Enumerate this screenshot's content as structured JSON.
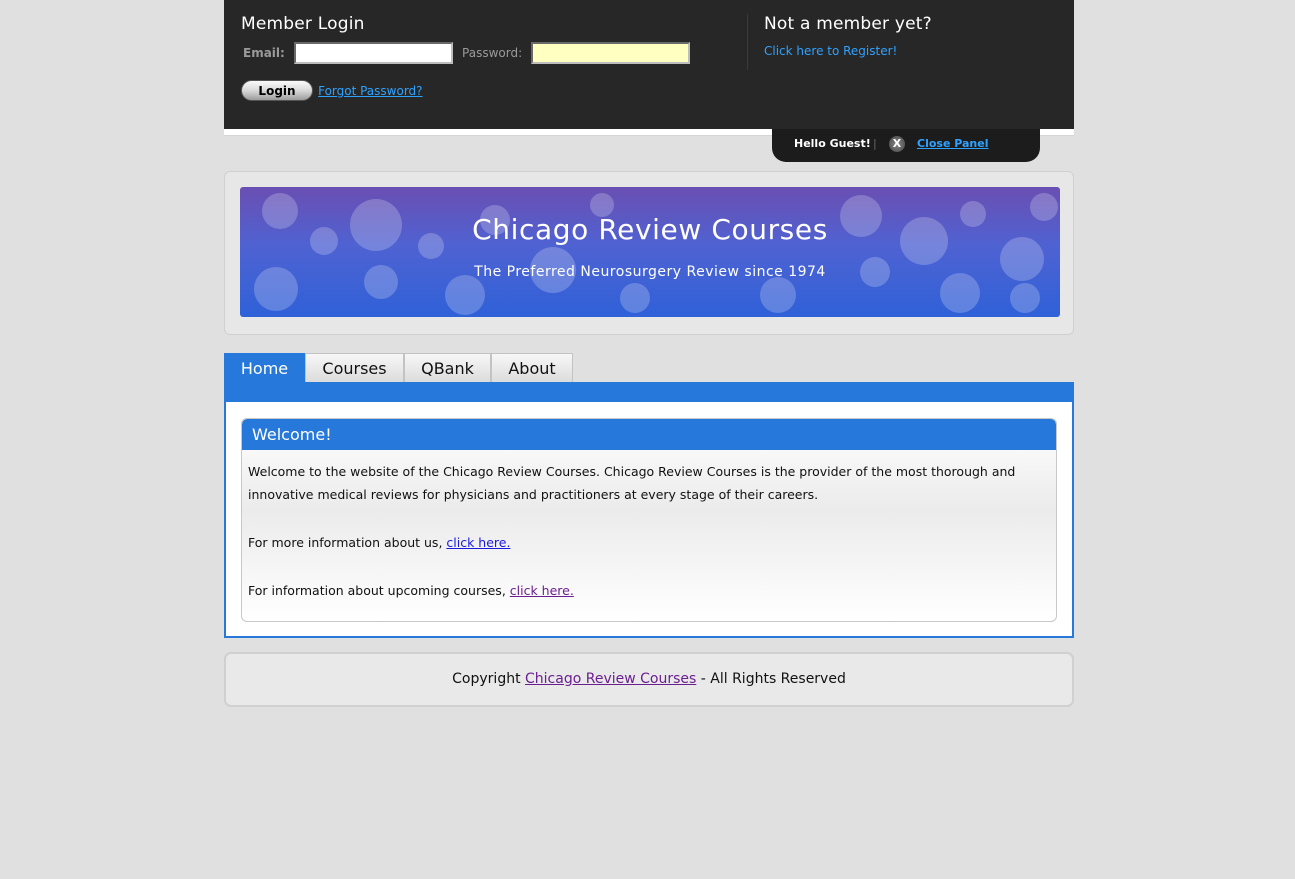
{
  "login_panel": {
    "heading": "Member Login",
    "email_label": "Email:",
    "email_value": "",
    "password_label": "Password:",
    "password_value": "",
    "login_button": "Login",
    "forgot_password": "Forgot Password?"
  },
  "register": {
    "heading": "Not a member yet?",
    "link": "Click here to Register!"
  },
  "panel_tab": {
    "greeting": "Hello Guest!",
    "separator": "|",
    "close_icon_glyph": "X",
    "close_label": "Close Panel"
  },
  "banner": {
    "title": "Chicago Review Courses",
    "subtitle": "The Preferred Neurosurgery Review since 1974"
  },
  "nav": {
    "tabs": [
      {
        "label": "Home",
        "active": true
      },
      {
        "label": "Courses",
        "active": false
      },
      {
        "label": "QBank",
        "active": false
      },
      {
        "label": "About",
        "active": false
      }
    ]
  },
  "welcome": {
    "heading": "Welcome!",
    "intro": "Welcome to the website of the Chicago Review Courses. Chicago Review Courses is the provider of the most thorough and innovative medical reviews for physicians and practitioners at every stage of their careers.",
    "about_text": "For more information about us, ",
    "about_link": "click here.",
    "courses_text": "For information about upcoming courses, ",
    "courses_link": "click here."
  },
  "footer": {
    "prefix": "Copyright ",
    "link": "Chicago Review Courses",
    "suffix": " - All Rights Reserved"
  },
  "colors": {
    "accent": "#2679db",
    "panel_bg": "#272727",
    "link_blue": "#2fa2ff"
  }
}
